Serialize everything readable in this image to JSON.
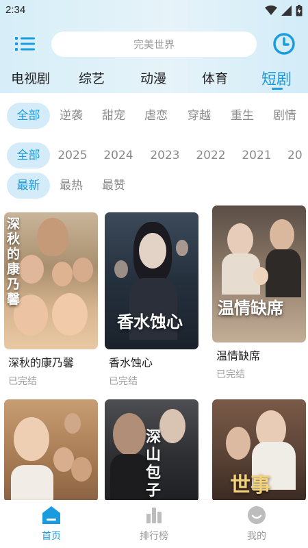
{
  "status_bar": {
    "time": "2:34"
  },
  "header": {
    "search_placeholder": "完美世界"
  },
  "categories": [
    {
      "label": "电视剧"
    },
    {
      "label": "综艺"
    },
    {
      "label": "动漫"
    },
    {
      "label": "体育"
    },
    {
      "label": "短剧",
      "active": true
    }
  ],
  "genres": [
    "全部",
    "逆袭",
    "甜宠",
    "虐恋",
    "穿越",
    "重生",
    "剧情"
  ],
  "years": [
    "全部",
    "2025",
    "2024",
    "2023",
    "2022",
    "2021",
    "20"
  ],
  "sorts": [
    "最新",
    "最热",
    "最赞"
  ],
  "cards": [
    {
      "title": "深秋的康乃馨",
      "status": "已完结",
      "poster_text": "深秋的康乃馨"
    },
    {
      "title": "香水蚀心",
      "status": "已完结",
      "poster_text": "香水蚀心"
    },
    {
      "title": "温情缺席",
      "status": "已完结",
      "poster_text": "温情缺席"
    },
    {
      "title": "",
      "status": "",
      "poster_text": ""
    },
    {
      "title": "",
      "status": "",
      "poster_text": "深山包子"
    },
    {
      "title": "",
      "status": "",
      "poster_text": "世事"
    }
  ],
  "bottom_nav": [
    {
      "label": "首页",
      "active": true
    },
    {
      "label": "排行榜"
    },
    {
      "label": "我的"
    }
  ],
  "colors": {
    "accent": "#1b9bdf",
    "chip_active_bg": "#d4ecf9",
    "muted": "#9a9a9a"
  }
}
